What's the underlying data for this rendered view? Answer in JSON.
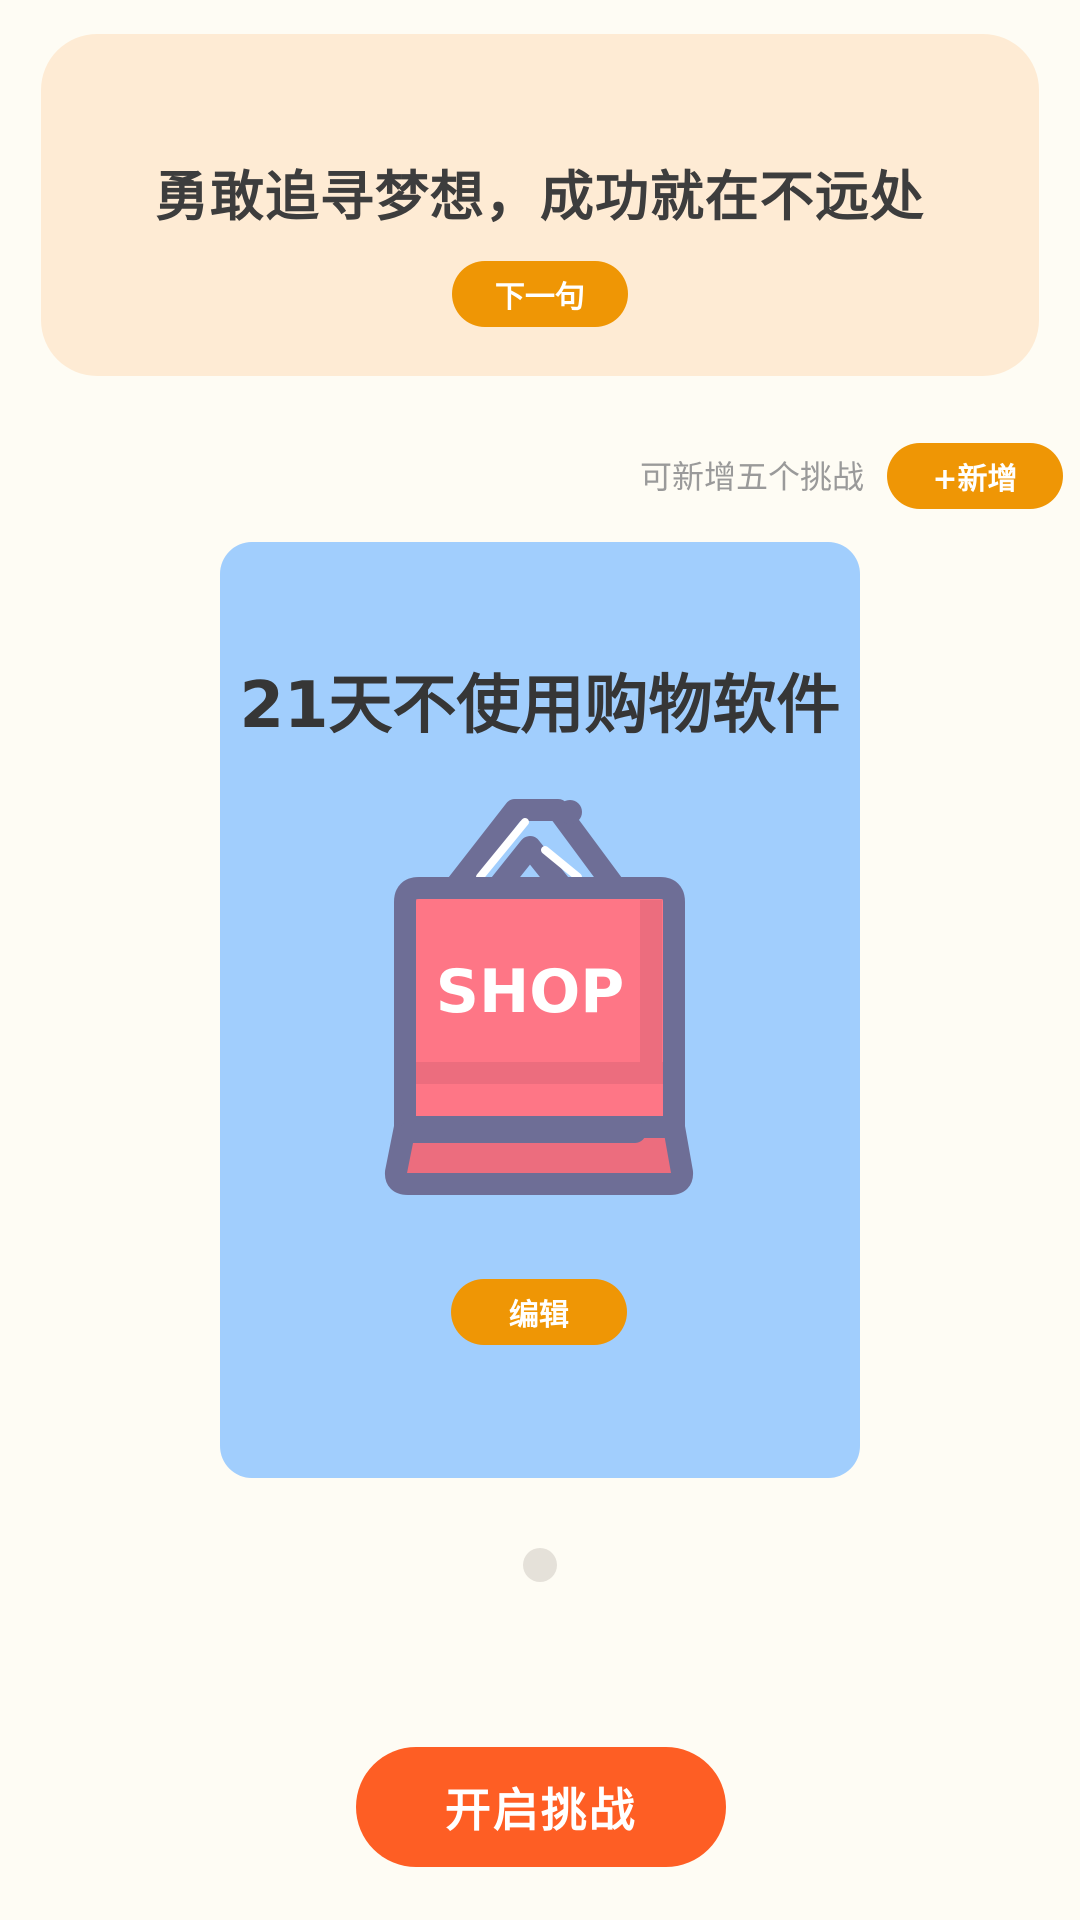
{
  "quote": {
    "text": "勇敢追寻梦想，成功就在不远处",
    "next_label": "下一句"
  },
  "challenges": {
    "remaining_text": "可新增五个挑战",
    "add_label": "+新增"
  },
  "card": {
    "title": "21天不使用购物软件",
    "illustration": "shopping-bag-icon",
    "illustration_text": "SHOP",
    "edit_label": "编辑"
  },
  "pager": {
    "total": 1,
    "current": 1
  },
  "start": {
    "label": "开启挑战"
  },
  "colors": {
    "background": "#fefcf4",
    "quote_card": "#feebd4",
    "accent": "#ef9605",
    "challenge_card": "#a1cefd",
    "start_button": "#fe5e24",
    "bag_body": "#fe7686",
    "bag_outline": "#6e6e96"
  }
}
